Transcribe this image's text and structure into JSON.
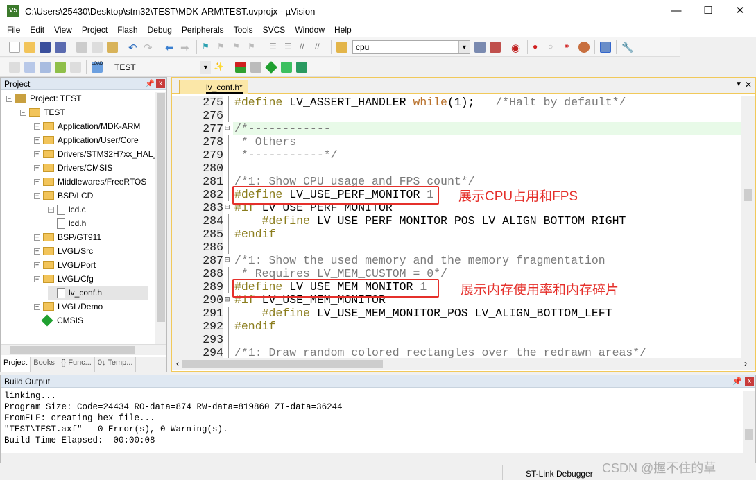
{
  "window": {
    "title": "C:\\Users\\25430\\Desktop\\stm32\\TEST\\MDK-ARM\\TEST.uvprojx - µVision",
    "minimize": "—",
    "maximize": "☐",
    "close": "✕"
  },
  "menu": [
    "File",
    "Edit",
    "View",
    "Project",
    "Flash",
    "Debug",
    "Peripherals",
    "Tools",
    "SVCS",
    "Window",
    "Help"
  ],
  "toolbar": {
    "find_combo": "cpu",
    "target_combo": "TEST",
    "load_label": "LOAD"
  },
  "project_panel": {
    "title": "Project",
    "tree": [
      {
        "label": "Project: TEST",
        "level": 0,
        "expanded": true,
        "type": "project"
      },
      {
        "label": "TEST",
        "level": 1,
        "expanded": true,
        "type": "target"
      },
      {
        "label": "Application/MDK-ARM",
        "level": 2,
        "expanded": false,
        "type": "folder"
      },
      {
        "label": "Application/User/Core",
        "level": 2,
        "expanded": false,
        "type": "folder"
      },
      {
        "label": "Drivers/STM32H7xx_HAL_",
        "level": 2,
        "expanded": false,
        "type": "folder"
      },
      {
        "label": "Drivers/CMSIS",
        "level": 2,
        "expanded": false,
        "type": "folder"
      },
      {
        "label": "Middlewares/FreeRTOS",
        "level": 2,
        "expanded": false,
        "type": "folder"
      },
      {
        "label": "BSP/LCD",
        "level": 2,
        "expanded": true,
        "type": "folder"
      },
      {
        "label": "lcd.c",
        "level": 3,
        "expanded": false,
        "type": "file"
      },
      {
        "label": "lcd.h",
        "level": 3,
        "type": "file"
      },
      {
        "label": "BSP/GT911",
        "level": 2,
        "expanded": false,
        "type": "folder"
      },
      {
        "label": "LVGL/Src",
        "level": 2,
        "expanded": false,
        "type": "folder"
      },
      {
        "label": "LVGL/Port",
        "level": 2,
        "expanded": false,
        "type": "folder"
      },
      {
        "label": "LVGL/Cfg",
        "level": 2,
        "expanded": true,
        "type": "folder"
      },
      {
        "label": "lv_conf.h",
        "level": 3,
        "type": "file",
        "selected": true
      },
      {
        "label": "LVGL/Demo",
        "level": 2,
        "expanded": false,
        "type": "folder"
      },
      {
        "label": "CMSIS",
        "level": 2,
        "type": "component"
      }
    ],
    "tabs": [
      "Project",
      "Books",
      "{} Func...",
      "0↓ Temp..."
    ]
  },
  "editor": {
    "tab": "lv_conf.h*",
    "lines": [
      {
        "n": "275",
        "parts": [
          [
            "pp",
            "#define"
          ],
          [
            "",
            "LV_ASSERT_HANDLER "
          ],
          [
            "kw",
            "while"
          ],
          [
            "",
            "(1);   "
          ],
          [
            "cm",
            "/*Halt by default*/"
          ]
        ]
      },
      {
        "n": "276",
        "parts": []
      },
      {
        "n": "277",
        "parts": [
          [
            "cm",
            "/*------------"
          ]
        ],
        "fold": "⊟",
        "current": true
      },
      {
        "n": "278",
        "parts": [
          [
            "cm",
            " * Others"
          ]
        ]
      },
      {
        "n": "279",
        "parts": [
          [
            "cm",
            " *-----------*/"
          ]
        ]
      },
      {
        "n": "280",
        "parts": []
      },
      {
        "n": "281",
        "parts": [
          [
            "cm",
            "/*1: Show CPU usage and FPS count*/"
          ]
        ]
      },
      {
        "n": "282",
        "parts": [
          [
            "pp",
            "#define"
          ],
          [
            "",
            "LV_USE_PERF_MONITOR "
          ],
          [
            "cm",
            "1"
          ]
        ]
      },
      {
        "n": "283",
        "parts": [
          [
            "pp",
            "#if"
          ],
          [
            "",
            "LV_USE_PERF_MONITOR"
          ]
        ],
        "fold": "⊟"
      },
      {
        "n": "284",
        "parts": [
          [
            "",
            "    "
          ],
          [
            "pp",
            "#define"
          ],
          [
            "",
            "LV_USE_PERF_MONITOR_POS LV_ALIGN_BOTTOM_RIGHT"
          ]
        ]
      },
      {
        "n": "285",
        "parts": [
          [
            "pp",
            "#endif"
          ]
        ]
      },
      {
        "n": "286",
        "parts": []
      },
      {
        "n": "287",
        "parts": [
          [
            "cm",
            "/*1: Show the used memory and the memory fragmentation"
          ]
        ],
        "fold": "⊟"
      },
      {
        "n": "288",
        "parts": [
          [
            "cm",
            " * Requires LV_MEM_CUSTOM = 0*/"
          ]
        ]
      },
      {
        "n": "289",
        "parts": [
          [
            "pp",
            "#define"
          ],
          [
            "",
            "LV_USE_MEM_MONITOR "
          ],
          [
            "cm",
            "1"
          ]
        ]
      },
      {
        "n": "290",
        "parts": [
          [
            "pp",
            "#if"
          ],
          [
            "",
            "LV_USE_MEM_MONITOR"
          ]
        ],
        "fold": "⊟"
      },
      {
        "n": "291",
        "parts": [
          [
            "",
            "    "
          ],
          [
            "pp",
            "#define"
          ],
          [
            "",
            "LV_USE_MEM_MONITOR_POS LV_ALIGN_BOTTOM_LEFT"
          ]
        ]
      },
      {
        "n": "292",
        "parts": [
          [
            "pp",
            "#endif"
          ]
        ]
      },
      {
        "n": "293",
        "parts": []
      },
      {
        "n": "294",
        "parts": [
          [
            "cm",
            "/*1: Draw random colored rectangles over the redrawn areas*/"
          ]
        ]
      }
    ],
    "annotations": [
      "展示CPU占用和FPS",
      "展示内存使用率和内存碎片"
    ]
  },
  "build_output": {
    "title": "Build Output",
    "lines": [
      "linking...",
      "Program Size: Code=24434 RO-data=874 RW-data=819860 ZI-data=36244",
      "FromELF: creating hex file...",
      "\"TEST\\TEST.axf\" - 0 Error(s), 0 Warning(s).",
      "Build Time Elapsed:  00:00:08"
    ]
  },
  "status": {
    "debugger": "ST-Link Debugger",
    "watermark": "CSDN @握不住的草"
  }
}
